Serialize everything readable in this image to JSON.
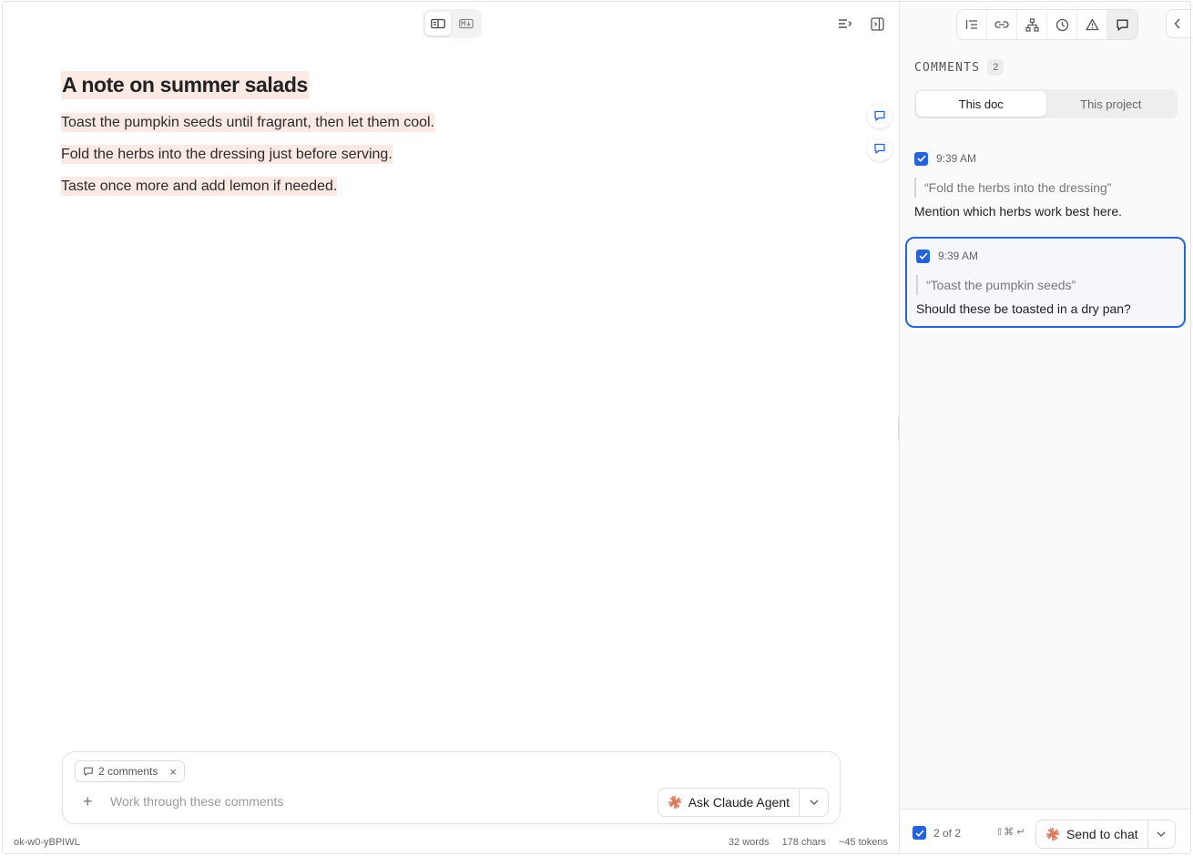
{
  "document": {
    "title": "A note on summer salads",
    "paragraphs": [
      "Toast the pumpkin seeds until fragrant, then let them cool.",
      "Fold the herbs into the dressing just before serving.",
      "Taste once more and add lemon if needed."
    ]
  },
  "composer": {
    "chip_label": "2 comments",
    "placeholder": "Work through these comments",
    "ask_label": "Ask Claude Agent"
  },
  "status": {
    "doc_id": "ok-w0-yBPIWL",
    "words": "32 words",
    "chars": "178 chars",
    "tokens": "~45 tokens"
  },
  "comments_panel": {
    "title": "COMMENTS",
    "count": "2",
    "tabs": [
      "This doc",
      "This project"
    ],
    "items": [
      {
        "time": "9:39 AM",
        "quote": "“Fold the herbs into the dressing”",
        "text": "Mention which herbs work best here."
      },
      {
        "time": "9:39 AM",
        "quote": "“Toast the pumpkin seeds”",
        "text": "Should these be toasted in a dry pan?"
      }
    ],
    "footer": {
      "selection": "2 of 2",
      "shortcut": "⇧⌘ ↵",
      "send_label": "Send to chat"
    }
  },
  "colors": {
    "accent": "#2563d6",
    "highlight": "#fbe9e3",
    "claude": "#d97757"
  }
}
